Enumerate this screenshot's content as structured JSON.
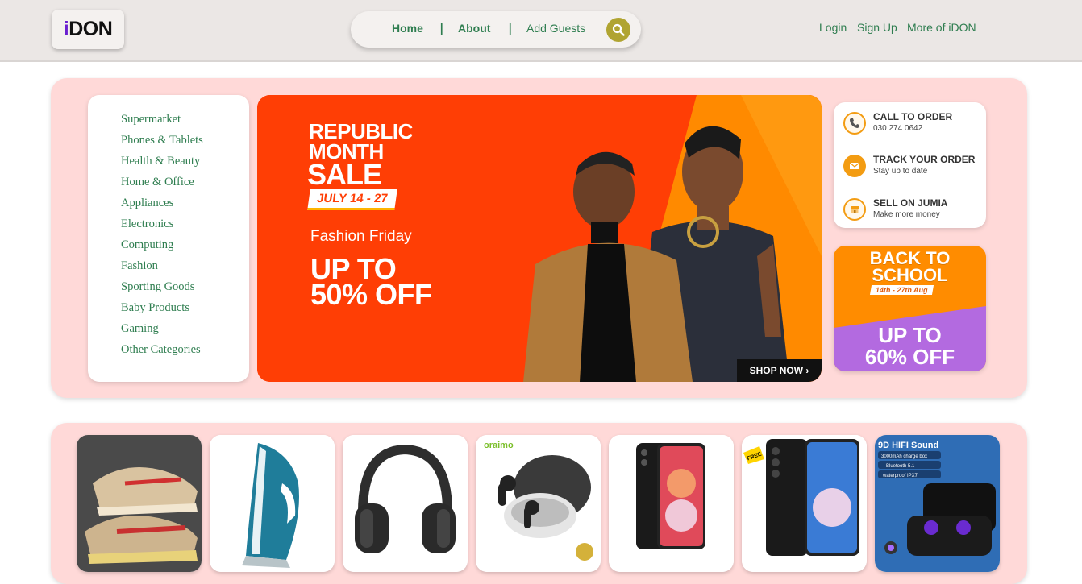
{
  "header": {
    "logo": {
      "mark": "i",
      "text": "DON"
    },
    "nav": [
      {
        "label": "Home"
      },
      {
        "label": "About"
      },
      {
        "label": "Add Guests"
      }
    ],
    "separator": "|",
    "links": [
      {
        "label": "Login"
      },
      {
        "label": "Sign Up"
      },
      {
        "label": "More of iDON"
      }
    ]
  },
  "categories": [
    "Supermarket",
    "Phones & Tablets",
    "Health & Beauty",
    "Home & Office",
    "Appliances",
    "Electronics",
    "Computing",
    "Fashion",
    "Sporting Goods",
    "Baby Products",
    "Gaming",
    "Other Categories"
  ],
  "banner": {
    "title_line1": "REPUBLIC",
    "title_line2": "MONTH",
    "sale": "SALE",
    "dates": "JULY 14 - 27",
    "subtitle": "Fashion Friday",
    "offer_line1": "UP TO",
    "offer_line2": "50% OFF",
    "cta": "SHOP NOW ›",
    "colors": {
      "background": "#ff3e05",
      "accent": "#ff8a00"
    }
  },
  "info": [
    {
      "title": "CALL TO ORDER",
      "subtitle": "030 274 0642",
      "icon": "phone-icon"
    },
    {
      "title": "TRACK YOUR ORDER",
      "subtitle": "Stay up to date",
      "icon": "envelope-icon"
    },
    {
      "title": "SELL ON JUMIA",
      "subtitle": "Make more money",
      "icon": "store-icon"
    }
  ],
  "promo": {
    "title_line1": "BACK TO",
    "title_line2": "SCHOOL",
    "dates": "14th - 27th Aug",
    "offer_line1": "UP TO",
    "offer_line2": "60% OFF",
    "colors": {
      "top": "#ff8c00",
      "bottom": "#b36ae0"
    }
  },
  "products": [
    {
      "name": "sneakers"
    },
    {
      "name": "steam-iron"
    },
    {
      "name": "headphones"
    },
    {
      "name": "oraimo-earbuds",
      "brand": "oraimo"
    },
    {
      "name": "samsung-phone-a"
    },
    {
      "name": "samsung-phone-b",
      "badge": "FREE"
    },
    {
      "name": "hifi-earbuds",
      "headline": "9D HIFI Sound",
      "specs": [
        "3000mAh charge box",
        "Bluetooth 5.1",
        "waterproof IPX7"
      ]
    }
  ],
  "colors": {
    "header_bg": "#ebe7e5",
    "link_green": "#2e7d4f",
    "panel_pink": "#ffd9d8",
    "search_olive": "#b0a431",
    "logo_purple": "#6a1fd0"
  }
}
